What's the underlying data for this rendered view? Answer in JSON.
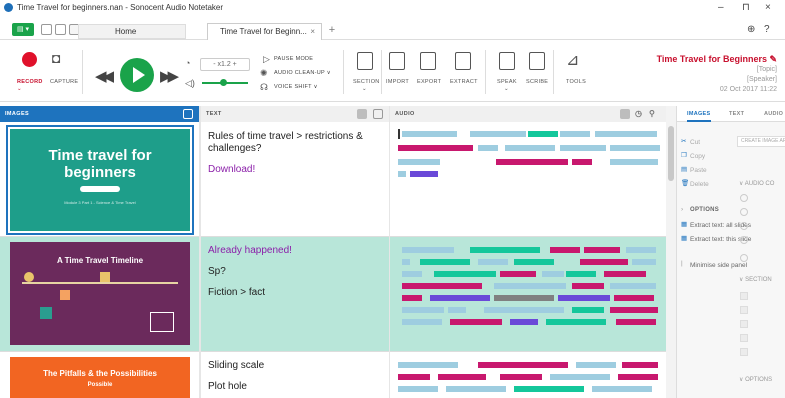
{
  "window": {
    "title": "Time Travel for beginners.nan - Sonocent Audio Notetaker",
    "minimize": "–",
    "maximize": "⊓",
    "close": "×"
  },
  "tabs": {
    "home": "Home",
    "document": "Time Travel for Beginn...",
    "close": "×",
    "add": "+"
  },
  "ribbon": {
    "record": "RECORD",
    "capture": "CAPTURE",
    "speed": "- x1.2 +",
    "pause_mode": "PAUSE MODE",
    "audio_cleanup": "AUDIO CLEAN-UP ∨",
    "voice_shift": "VOICE SHIFT ∨",
    "section": "SECTION",
    "import": "IMPORT",
    "export": "EXPORT",
    "extract": "EXTRACT",
    "speak": "SPEAK",
    "scribe": "SCRIBE",
    "tools": "TOOLS"
  },
  "document_info": {
    "title": "Time Travel for Beginners",
    "topic": "[Topic]",
    "speaker": "[Speaker]",
    "date": "02 Oct 2017 11:22"
  },
  "columns": {
    "images": "IMAGES",
    "text": "TEXT",
    "audio": "AUDIO"
  },
  "rows": [
    {
      "slide_title": "Time travel for beginners",
      "slide_subtitle": "Module 3 Part 1 - Science & Time Travel",
      "text": [
        "Rules of time travel > restrictions & challenges?",
        "Download!"
      ]
    },
    {
      "slide_title": "A Time Travel Timeline",
      "text": [
        "Already happened!",
        "Sp?",
        "Fiction > fact"
      ]
    },
    {
      "slide_title": "The Pitfalls & the Possibilities",
      "slide_subtitle": "Possible",
      "text": [
        "Sliding scale",
        "Plot hole"
      ]
    }
  ],
  "side_panel": {
    "tabs": [
      "IMAGES",
      "TEXT",
      "AUDIO"
    ],
    "create_button": "CREATE IMAGE AREA",
    "items": [
      "Cut",
      "Copy",
      "Paste",
      "Delete"
    ],
    "options_heading": "OPTIONS",
    "extract_all": "Extract text: all slides",
    "extract_this": "Extract text: this slide",
    "minimise": "Minimise side panel",
    "audio_col": "AUDIO CO",
    "section_col": "SECTION",
    "options2": "OPTIONS",
    "colors": {
      "accent": "#1e73be",
      "brand_red": "#c8102e",
      "record_red": "#e0112b",
      "play_green": "#1aa34a",
      "teal": "#1e9e8a",
      "purple": "#6b2a5c",
      "orange": "#f26522",
      "bar_blue": "#9ecde0",
      "bar_magenta": "#c8186e",
      "bar_teal": "#14c79b",
      "bar_violet": "#6a49d8",
      "bar_grey": "#808080"
    }
  }
}
